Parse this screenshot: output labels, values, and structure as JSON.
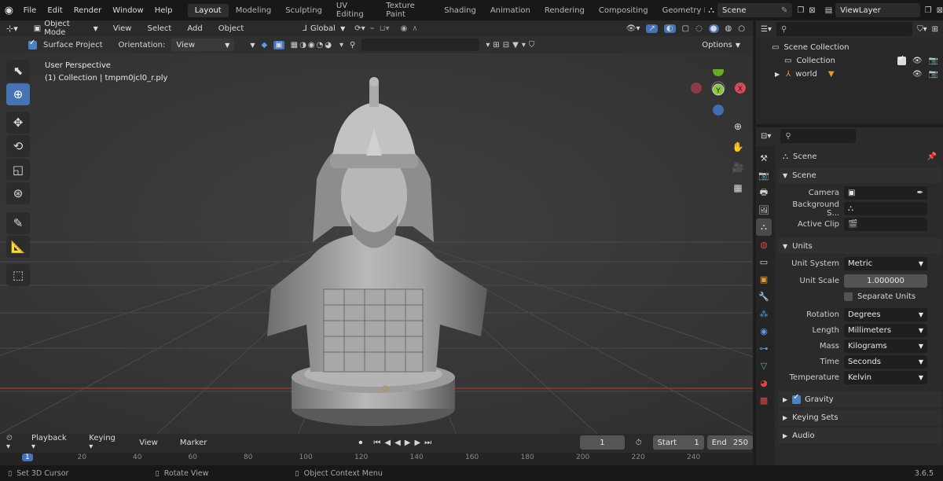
{
  "topbar": {
    "menus": [
      "File",
      "Edit",
      "Render",
      "Window",
      "Help"
    ],
    "workspaces": [
      "Layout",
      "Modeling",
      "Sculpting",
      "UV Editing",
      "Texture Paint",
      "Shading",
      "Animation",
      "Rendering",
      "Compositing",
      "Geometry Noc"
    ],
    "active_workspace": "Layout",
    "scene_name": "Scene",
    "view_layer": "ViewLayer"
  },
  "viewport": {
    "mode": "Object Mode",
    "menus": [
      "View",
      "Select",
      "Add",
      "Object"
    ],
    "transform_orientation": "Global",
    "surface_project_label": "Surface Project",
    "orientation_label": "Orientation:",
    "orientation_value": "View",
    "options_label": "Options",
    "info_line1": "User Perspective",
    "info_line2": "(1) Collection | tmpm0jcl0_r.ply",
    "accent": "#4772b3"
  },
  "timeline": {
    "menus": [
      "Playback",
      "Keying",
      "View",
      "Marker"
    ],
    "current_frame": "1",
    "start_label": "Start",
    "start_value": "1",
    "end_label": "End",
    "end_value": "250",
    "ruler": [
      "1",
      "20",
      "40",
      "60",
      "80",
      "100",
      "120",
      "140",
      "160",
      "180",
      "200",
      "220",
      "240"
    ]
  },
  "statusbar": {
    "hint1": "Set 3D Cursor",
    "hint2": "Rotate View",
    "hint3": "Object Context Menu",
    "version": "3.6.5"
  },
  "outliner": {
    "root": "Scene Collection",
    "collection": "Collection",
    "object": "world"
  },
  "properties": {
    "context_title": "Scene",
    "scene_section": "Scene",
    "camera_label": "Camera",
    "background_label": "Background S...",
    "active_clip_label": "Active Clip",
    "units_section": "Units",
    "unit_system_label": "Unit System",
    "unit_system_value": "Metric",
    "unit_scale_label": "Unit Scale",
    "unit_scale_value": "1.000000",
    "separate_units_label": "Separate Units",
    "rotation_label": "Rotation",
    "rotation_value": "Degrees",
    "length_label": "Length",
    "length_value": "Millimeters",
    "mass_label": "Mass",
    "mass_value": "Kilograms",
    "time_label": "Time",
    "time_value": "Seconds",
    "temperature_label": "Temperature",
    "temperature_value": "Kelvin",
    "gravity_label": "Gravity",
    "keying_sets_label": "Keying Sets",
    "audio_label": "Audio"
  }
}
